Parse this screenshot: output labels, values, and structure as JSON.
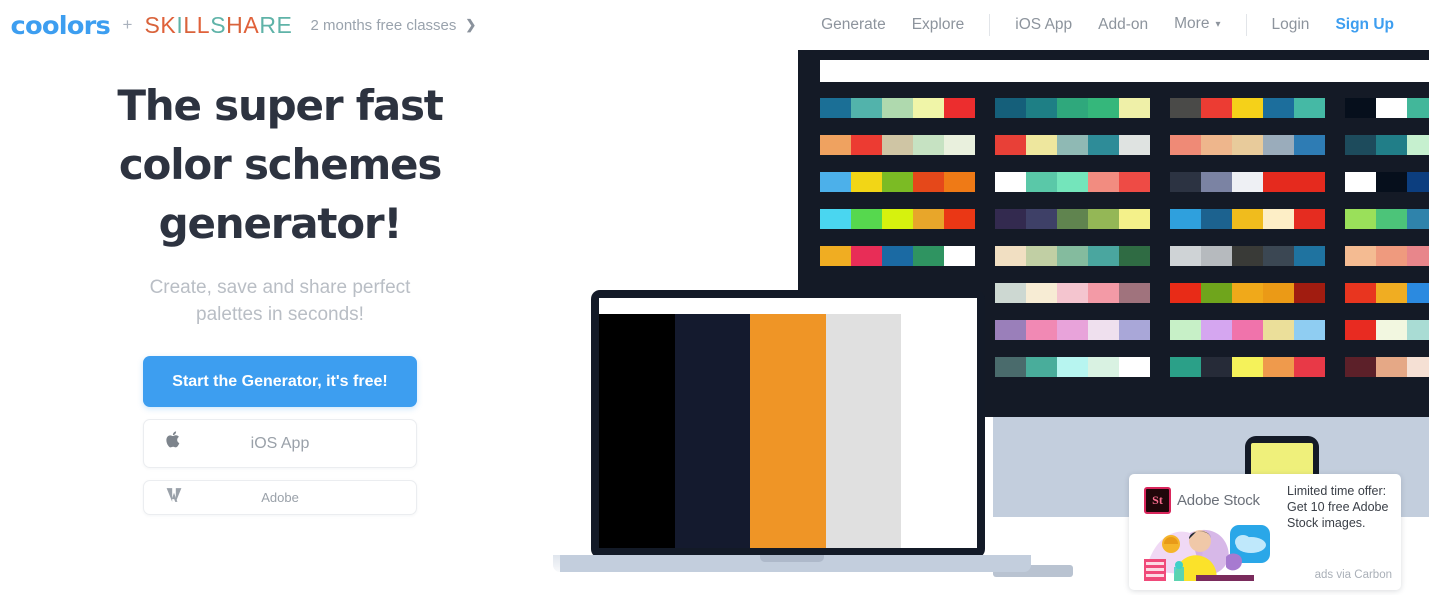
{
  "nav": {
    "brand": "coolors",
    "plus": "+",
    "partner_letters": [
      {
        "ch": "S",
        "color": "#d9633b"
      },
      {
        "ch": "K",
        "color": "#e0613a"
      },
      {
        "ch": "I",
        "color": "#5fb3a8"
      },
      {
        "ch": "L",
        "color": "#d9633b"
      },
      {
        "ch": "L",
        "color": "#e0613a"
      },
      {
        "ch": "S",
        "color": "#5fb3a8"
      },
      {
        "ch": "H",
        "color": "#d9633b"
      },
      {
        "ch": "A",
        "color": "#e0613a"
      },
      {
        "ch": "R",
        "color": "#5fb3a8"
      },
      {
        "ch": "E",
        "color": "#5fb3a8"
      }
    ],
    "partner_name": "SKILLSHARE",
    "promo": "2 months free classes",
    "promo_arrow": "❯",
    "links_left": [
      {
        "label": "Generate",
        "name": "nav-generate"
      },
      {
        "label": "Explore",
        "name": "nav-explore"
      }
    ],
    "links_mid": [
      {
        "label": "iOS App",
        "name": "nav-ios-app"
      },
      {
        "label": "Add-on",
        "name": "nav-addon"
      },
      {
        "label": "More",
        "name": "nav-more",
        "chevron": "▾"
      }
    ],
    "links_right": [
      {
        "label": "Login",
        "name": "nav-login",
        "accent": false
      },
      {
        "label": "Sign Up",
        "name": "nav-signup",
        "accent": true
      }
    ],
    "accent_color": "#3d9ef0"
  },
  "hero": {
    "headline_line1": "The super fast",
    "headline_line2": "color schemes",
    "headline_line3": "generator!",
    "headline": "The super fast color schemes generator!",
    "subhead_line1": "Create, save and share perfect",
    "subhead_line2": "palettes in seconds!",
    "subhead": "Create, save and share perfect palettes in seconds!",
    "cta_label": "Start the Generator, it's free!",
    "ios_label": "iOS App",
    "adobe_label": "Adobe",
    "cta_color": "#3d9ef0"
  },
  "ad": {
    "brand_badge": "St",
    "brand_name": "Adobe Stock",
    "body": "Limited time offer: Get 10 free Adobe Stock images.",
    "attribution": "ads via Carbon"
  },
  "mockups": {
    "monitor_bg": "#141a26",
    "laptop_palette": [
      "#000000",
      "#141a2e",
      "#ef9526",
      "#e0e0e0",
      "#ffffff"
    ],
    "phone_palette": [
      "#eff07b",
      "#8cb45a"
    ],
    "monitor_palettes": [
      [
        "#1b6f96",
        "#52b3ab",
        "#afd9ae",
        "#f0f5a8",
        "#ec2d2e"
      ],
      [
        "#155f7a",
        "#1e7f85",
        "#2fa87c",
        "#35b77b",
        "#eff0a8"
      ],
      [
        "#4a4a48",
        "#ec3c33",
        "#f5d119",
        "#1c6e9c",
        "#45b9a5"
      ],
      [
        "#060f1c",
        "#ffffff",
        "#42b79a",
        "#ed2f24",
        "#f49a1c"
      ],
      [
        "#efa260",
        "#ec3b32",
        "#cfc5a4",
        "#c6e2c2",
        "#e9f0dd"
      ],
      [
        "#e84037",
        "#eee79e",
        "#8fb9b4",
        "#2e8c98",
        "#dfe3e1"
      ],
      [
        "#ef8a76",
        "#eeb68c",
        "#e8cb9b",
        "#9aacbb",
        "#2e7cb4"
      ],
      [
        "#1d4b5c",
        "#217e88",
        "#c6f0cf",
        "#3a5a92",
        "#e8304f"
      ],
      [
        "#4cb0ea",
        "#f2d616",
        "#7bbb24",
        "#e5481a",
        "#ef7a16"
      ],
      [
        "#ffffff",
        "#5ac8a8",
        "#74e5bb",
        "#f28c80",
        "#ee4b45"
      ],
      [
        "#2c3342",
        "#7b83a3",
        "#eef0f4",
        "#e52a1e",
        "#e52a1e"
      ],
      [
        "#ffffff",
        "#060f1c",
        "#0c3e7f",
        "#1a6fb5",
        "#2b8ae0"
      ],
      [
        "#4ad6f0",
        "#56d84e",
        "#d6f20e",
        "#e8a62a",
        "#ea3715"
      ],
      [
        "#332a4f",
        "#3e4067",
        "#60844f",
        "#94b756",
        "#f4f18a"
      ],
      [
        "#2fa0dd",
        "#1c628f",
        "#f0bc1d",
        "#fdeec6",
        "#e52c20"
      ],
      [
        "#9ae05a",
        "#4cc479",
        "#2f83ab",
        "#4c4269",
        "#5b4a6e"
      ],
      [
        "#f0ad22",
        "#e82d57",
        "#1b6aa3",
        "#2f9461",
        "#ffffff"
      ],
      [
        "#f1dfc2",
        "#c1cfa4",
        "#84bb9e",
        "#4aa69f",
        "#2f6b43"
      ],
      [
        "#cfd3d6",
        "#b6babe",
        "#393a37",
        "#3b4753",
        "#1f73a0"
      ],
      [
        "#f4bb92",
        "#ef9a7e",
        "#e8868b",
        "#b1767f",
        "#a06a79"
      ],
      [
        "#cdd8d2",
        "#f7ecd4",
        "#f4c5cf",
        "#f39aa6",
        "#a0737d"
      ],
      [
        "#e82b17",
        "#6fa51c",
        "#f0a91a",
        "#eb9a16",
        "#a11c10"
      ],
      [
        "#e8351f",
        "#f0ad22",
        "#2b8ae0",
        "#7bbb24",
        "#103a6e"
      ],
      [
        "#9a7fba",
        "#f189b4",
        "#e8a3da",
        "#efe0ee",
        "#a9a7d8"
      ],
      [
        "#c7f0c7",
        "#d5a6f0",
        "#f073ab",
        "#ebdf9a",
        "#8fcdf2"
      ],
      [
        "#e82b21",
        "#f2f7e0",
        "#a9dcd4",
        "#3c6e92",
        "#1a3b66"
      ],
      [
        "#4a6b6c",
        "#49ad9b",
        "#b7f5f0",
        "#d9f2e2",
        "#ffffff"
      ],
      [
        "#2ba088",
        "#262b38",
        "#f5f25a",
        "#ef9a4c",
        "#e83947"
      ],
      [
        "#5c2029",
        "#e5a886",
        "#f5e0d4",
        "#140508",
        "#e5302c"
      ]
    ]
  }
}
